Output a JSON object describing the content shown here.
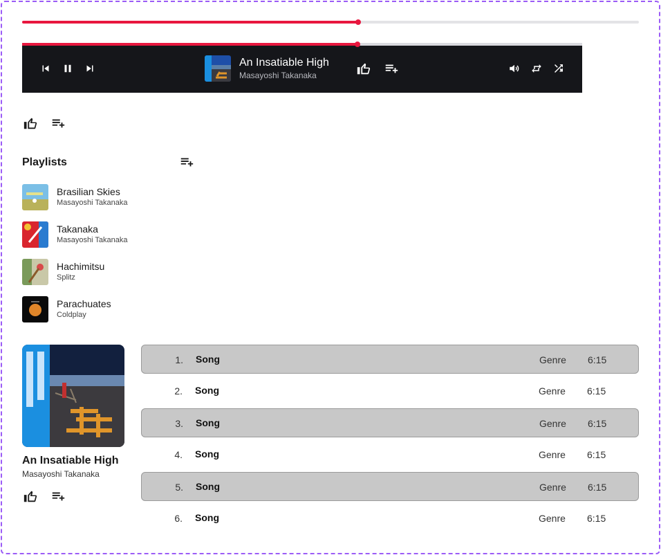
{
  "progress": {
    "played_fraction": 0.545
  },
  "player": {
    "played_fraction": 0.599,
    "now_playing": {
      "title": "An Insatiable High",
      "artist": "Masayoshi Takanaka"
    },
    "icons": [
      "skip-previous-icon",
      "pause-icon",
      "skip-next-icon",
      "thumbs-up-icon",
      "add-to-queue-icon",
      "volume-icon",
      "repeat-icon",
      "shuffle-icon"
    ]
  },
  "playlists": {
    "title": "Playlists",
    "items": [
      {
        "name": "Brasilian Skies",
        "artist": "Masayoshi Takanaka"
      },
      {
        "name": "Takanaka",
        "artist": "Masayoshi Takanaka"
      },
      {
        "name": "Hachimitsu",
        "artist": "Splitz"
      },
      {
        "name": "Parachuates",
        "artist": "Coldplay"
      }
    ]
  },
  "album": {
    "title": "An Insatiable High",
    "artist": "Masayoshi Takanaka"
  },
  "tracks": [
    {
      "num": "1.",
      "name": "Song",
      "genre": "Genre",
      "duration": "6:15"
    },
    {
      "num": "2.",
      "name": "Song",
      "genre": "Genre",
      "duration": "6:15"
    },
    {
      "num": "3.",
      "name": "Song",
      "genre": "Genre",
      "duration": "6:15"
    },
    {
      "num": "4.",
      "name": "Song",
      "genre": "Genre",
      "duration": "6:15"
    },
    {
      "num": "5.",
      "name": "Song",
      "genre": "Genre",
      "duration": "6:15"
    },
    {
      "num": "6.",
      "name": "Song",
      "genre": "Genre",
      "duration": "6:15"
    }
  ],
  "colors": {
    "accent": "#e8173f",
    "player_bg": "#15161a",
    "row_shade": "#c8c8c8",
    "frame": "#9b5cf6"
  }
}
